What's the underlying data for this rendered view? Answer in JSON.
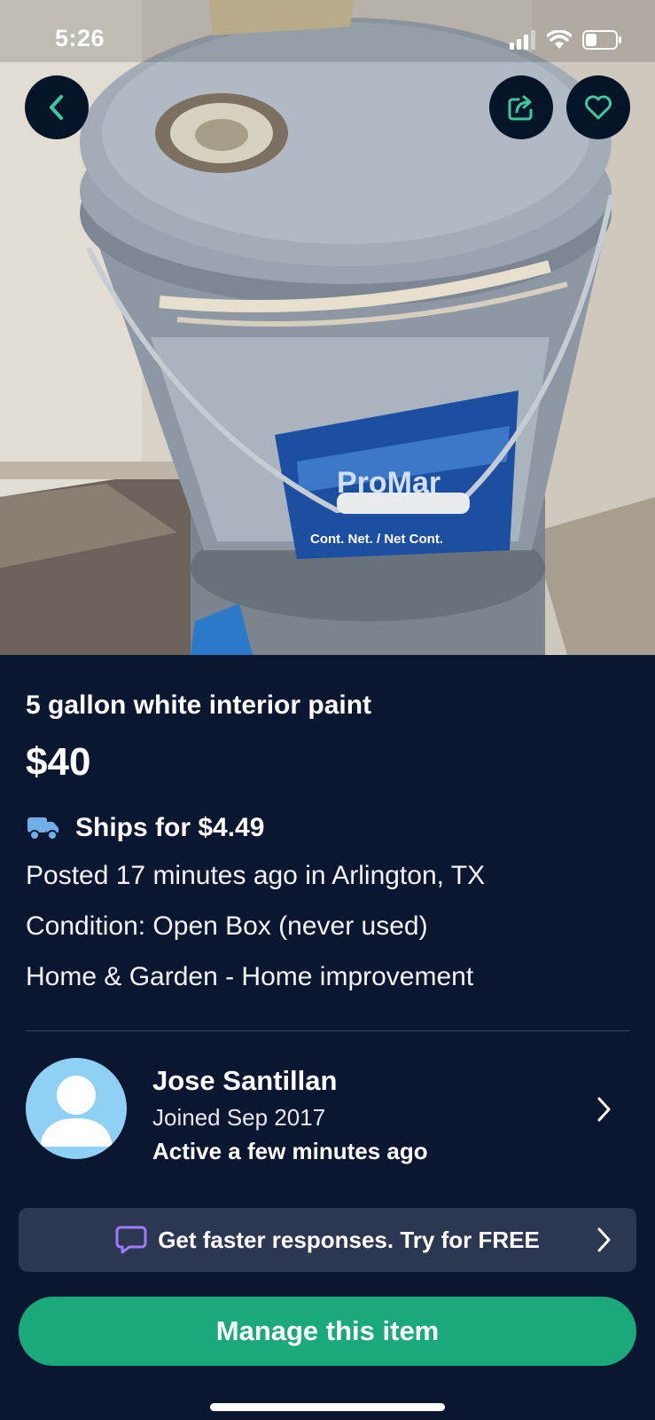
{
  "status_bar": {
    "time": "5:26"
  },
  "listing": {
    "title": "5 gallon white interior paint",
    "price": "$40",
    "shipping": "Ships for $4.49",
    "posted": "Posted 17 minutes ago in Arlington, TX",
    "condition": "Condition: Open Box (never used)",
    "category": "Home & Garden - Home improvement"
  },
  "seller": {
    "name": "Jose Santillan",
    "joined": "Joined Sep 2017",
    "activity": "Active a few minutes ago"
  },
  "promo": {
    "text": "Get faster responses.  Try for FREE"
  },
  "actions": {
    "manage_label": "Manage this item"
  },
  "icons": {
    "back": "chevron-left-icon",
    "share": "share-icon",
    "favorite": "heart-icon",
    "shipping": "truck-icon",
    "promo": "chat-bubble-icon",
    "chevron": "chevron-right-icon"
  },
  "colors": {
    "background": "#0b1630",
    "accent": "#1aa97a",
    "icon_accent": "#3cc9a0",
    "promo_bg": "#2c3752",
    "truck": "#6fb0e8",
    "chat": "#9d7cf5"
  }
}
